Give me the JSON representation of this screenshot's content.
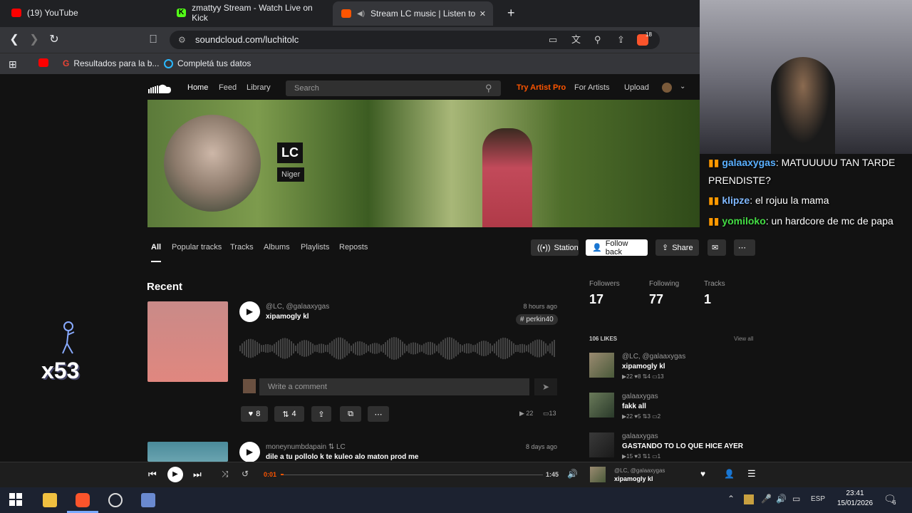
{
  "browser": {
    "tabs": [
      {
        "label": "(19) YouTube",
        "color": "#ff0000"
      },
      {
        "label": "zmattyy Stream - Watch Live on Kick",
        "color": "#53fc18"
      },
      {
        "label": "Stream LC music | Listen to so",
        "color": "#ff5500"
      }
    ],
    "new_tab": "+",
    "close_tab": "✕",
    "url": "soundcloud.com/luchitolc",
    "bookmarks": [
      "Resultados para la b...",
      "Completá tus datos"
    ],
    "brave_badge": "18"
  },
  "soundcloud": {
    "nav": [
      "Home",
      "Feed",
      "Library"
    ],
    "search_placeholder": "Search",
    "try_pro": "Try Artist Pro",
    "for_artists": "For Artists",
    "upload": "Upload",
    "accent": "#ff5500"
  },
  "profile": {
    "name": "LC",
    "location": "Niger",
    "tabs": [
      "All",
      "Popular tracks",
      "Tracks",
      "Albums",
      "Playlists",
      "Reposts"
    ],
    "buttons": {
      "station": "Station",
      "follow": "Follow back",
      "share": "Share"
    },
    "stats": [
      {
        "label": "Followers",
        "value": "17"
      },
      {
        "label": "Following",
        "value": "77"
      },
      {
        "label": "Tracks",
        "value": "1"
      }
    ],
    "likes_header": "106 LIKES",
    "view_all": "View all"
  },
  "recent": {
    "heading": "Recent",
    "tracks": [
      {
        "artist": "@LC, @galaaxygas",
        "title": "xipamogly kl",
        "time": "8 hours ago",
        "tag": "# perkin40",
        "comment_placeholder": "Write a comment",
        "likes": "8",
        "reposts": "4",
        "plays": "22",
        "comments": "13"
      },
      {
        "artist": "moneynumbdapain",
        "repost_by": "LC",
        "title": "dile a tu pollolo k te kuleo alo maton prod me",
        "time": "8 days ago"
      }
    ]
  },
  "likes": [
    {
      "artist": "@LC, @galaaxygas",
      "title": "xipamogly kl",
      "plays": "22",
      "likes": "8",
      "reposts": "4",
      "comments": "13"
    },
    {
      "artist": "galaaxygas",
      "title": "fakk all",
      "plays": "22",
      "likes": "5",
      "reposts": "3",
      "comments": "2"
    },
    {
      "artist": "galaaxygas",
      "title": "GASTANDO TO LO QUE HICE AYER",
      "plays": "15",
      "likes": "3",
      "reposts": "1",
      "comments": "1"
    }
  ],
  "player": {
    "elapsed": "0:01",
    "duration": "1:45",
    "progress": 0.01,
    "artist": "@LC, @galaaxygas",
    "title": "xipamogly kl"
  },
  "chat": [
    {
      "user": "galaaxygas",
      "text": ": MATUUUUU TAN TARDE PRENDISTE?",
      "color": "#5ab0ff"
    },
    {
      "user": "klipze",
      "text": ": el rojuu la mama",
      "color": "#7fb8ff"
    },
    {
      "user": "yomiloko",
      "text": ": un hardcore de mc de papa",
      "color": "#44dd44"
    }
  ],
  "overlay": {
    "combo": "x53"
  },
  "taskbar": {
    "lang": "ESP",
    "time": "23:41",
    "date": "15/01/2026",
    "notifications": "6"
  }
}
